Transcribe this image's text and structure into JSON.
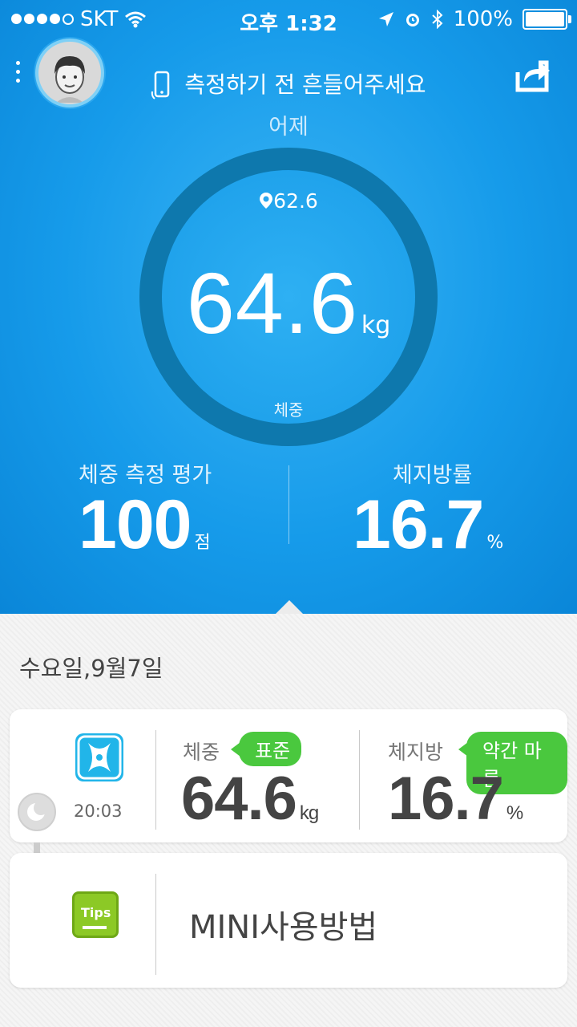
{
  "status_bar": {
    "carrier": "SKT",
    "time": "오후 1:32",
    "battery": "100%"
  },
  "header": {
    "hint": "측정하기 전 흔들어주세요",
    "period_label": "어제"
  },
  "gauge": {
    "goal_value": "62.6",
    "weight_value": "64.6",
    "weight_unit": "kg",
    "weight_label": "체중"
  },
  "stats": {
    "score_label": "체중 측정 평가",
    "score_value": "100",
    "score_unit": "점",
    "fat_label": "체지방률",
    "fat_value": "16.7",
    "fat_unit": "%"
  },
  "history": {
    "date": "수요일,9월7일",
    "entry": {
      "time": "20:03",
      "weight_label": "체중",
      "weight_status": "표준",
      "weight_value": "64.6",
      "weight_unit": "kg",
      "fat_label": "체지방",
      "fat_status": "약간 마름",
      "fat_value": "16.7",
      "fat_unit": "%"
    },
    "tips_icon_text": "Tips",
    "tips_label": "MINI사용방법"
  },
  "colors": {
    "primary_blue": "#169bea",
    "ring": "#0e78ad",
    "badge_green": "#4ac83e",
    "tips_green": "#8cc926"
  }
}
